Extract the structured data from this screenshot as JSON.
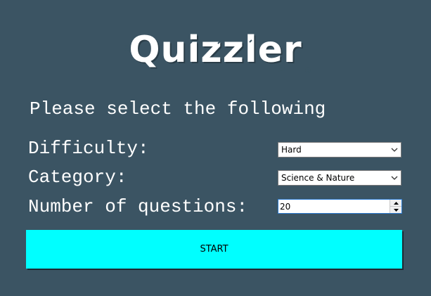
{
  "app": {
    "logo_text": "Quizzler",
    "colors": {
      "background": "#3b5463",
      "start_button": "#00ffff",
      "text": "#ffffff"
    }
  },
  "form": {
    "heading": "Please select the following",
    "difficulty": {
      "label": "Difficulty:",
      "value": "Hard",
      "icon": "chevron-down-icon"
    },
    "category": {
      "label": "Category:",
      "value": "Science & Nature",
      "icon": "chevron-down-icon"
    },
    "number_of_questions": {
      "label": "Number of questions:",
      "value": "20",
      "icons": [
        "spin-up-icon",
        "spin-down-icon"
      ]
    },
    "start_label": "START"
  }
}
